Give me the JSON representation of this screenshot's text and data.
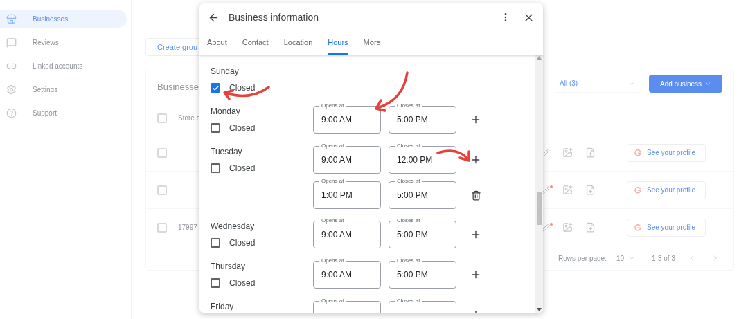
{
  "sidebar": {
    "items": [
      {
        "label": "Businesses",
        "selected": true
      },
      {
        "label": "Reviews",
        "selected": false
      },
      {
        "label": "Linked accounts",
        "selected": false
      },
      {
        "label": "Settings",
        "selected": false
      },
      {
        "label": "Support",
        "selected": false
      }
    ]
  },
  "toolbar": {
    "create_group": "Create grou",
    "filter": "All (3)",
    "add_business": "Add business"
  },
  "card": {
    "title": "Businesse",
    "header": {
      "checked": false,
      "column_1": "Store c"
    },
    "rows": [
      {
        "checked": false,
        "flagged": false,
        "profile_button": "See your profile"
      },
      {
        "checked": false,
        "flagged": true,
        "profile_button": "See your profile"
      },
      {
        "checked": false,
        "column_1": "17997",
        "flagged": true,
        "profile_button": "See your profile"
      }
    ],
    "footer": {
      "rows_per_page_label": "Rows per page:",
      "rows_per_page": "10",
      "range": "1-3 of 3"
    }
  },
  "dialog": {
    "title": "Business information",
    "tabs": [
      {
        "label": "About",
        "selected": false
      },
      {
        "label": "Contact",
        "selected": false
      },
      {
        "label": "Location",
        "selected": false
      },
      {
        "label": "Hours",
        "selected": true
      },
      {
        "label": "More",
        "selected": false
      }
    ],
    "days": [
      {
        "name": "Sunday",
        "closed": true,
        "closed_label": "Closed"
      },
      {
        "name": "Monday",
        "closed": false,
        "closed_label": "Closed",
        "intervals": [
          {
            "opens_label": "Opens at",
            "opens": "9:00 AM",
            "closes_label": "Closes at",
            "closes": "5:00 PM",
            "kind": "add"
          }
        ]
      },
      {
        "name": "Tuesday",
        "closed": false,
        "closed_label": "Closed",
        "intervals": [
          {
            "opens_label": "Opens at",
            "opens": "9:00 AM",
            "closes_label": "Closes at",
            "closes": "12:00 PM",
            "kind": "add"
          },
          {
            "opens_label": "Opens at",
            "opens": "1:00 PM",
            "closes_label": "Closes at",
            "closes": "5:00 PM",
            "kind": "delete"
          }
        ]
      },
      {
        "name": "Wednesday",
        "closed": false,
        "closed_label": "Closed",
        "intervals": [
          {
            "opens_label": "Opens at",
            "opens": "9:00 AM",
            "closes_label": "Closes at",
            "closes": "5:00 PM",
            "kind": "add"
          }
        ]
      },
      {
        "name": "Thursday",
        "closed": false,
        "closed_label": "Closed",
        "intervals": [
          {
            "opens_label": "Opens at",
            "opens": "9:00 AM",
            "closes_label": "Closes at",
            "closes": "5:00 PM",
            "kind": "add"
          }
        ]
      },
      {
        "name": "Friday",
        "intervals": [
          {
            "opens_label": "Opens at",
            "closes_label": "Closes at",
            "kind": "add"
          }
        ]
      }
    ]
  }
}
